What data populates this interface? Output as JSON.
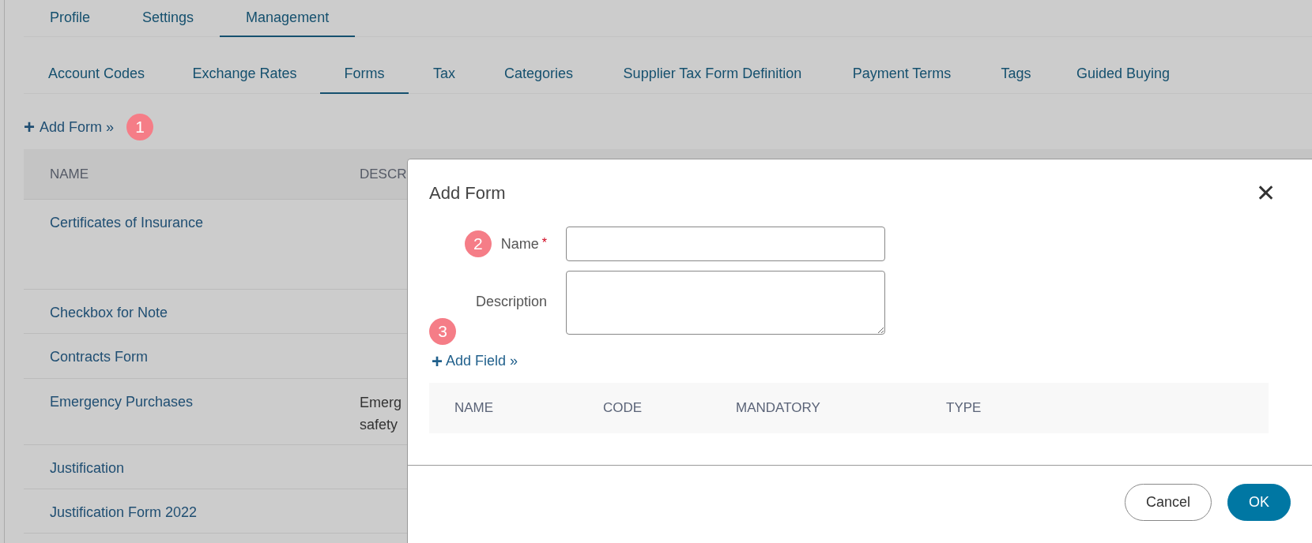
{
  "top_tabs": [
    {
      "label": "Profile",
      "selected": false
    },
    {
      "label": "Settings",
      "selected": false
    },
    {
      "label": "Management",
      "selected": true
    }
  ],
  "sub_tabs": [
    {
      "label": "Account Codes",
      "selected": false
    },
    {
      "label": "Exchange Rates",
      "selected": false
    },
    {
      "label": "Forms",
      "selected": true
    },
    {
      "label": "Tax",
      "selected": false
    },
    {
      "label": "Categories",
      "selected": false
    },
    {
      "label": "Supplier Tax Form Definition",
      "selected": false
    },
    {
      "label": "Payment Terms",
      "selected": false
    },
    {
      "label": "Tags",
      "selected": false
    },
    {
      "label": "Guided Buying",
      "selected": false
    }
  ],
  "add_form_link": {
    "icon": "+",
    "label": "Add Form »",
    "callout": "1"
  },
  "table": {
    "columns": [
      "NAME",
      "DESCR"
    ],
    "rows": [
      {
        "name": "Certificates of Insurance"
      },
      {
        "name": "Checkbox for Note"
      },
      {
        "name": "Contracts Form"
      },
      {
        "name": "Emergency Purchases",
        "description_lines": [
          "Emerg",
          "safety"
        ]
      },
      {
        "name": "Justification"
      },
      {
        "name": "Justification Form 2022"
      }
    ]
  },
  "dialog": {
    "title": "Add Form",
    "close": "✕",
    "required_mark": "*",
    "fields": [
      {
        "kind": "input",
        "label": "Name",
        "required": true,
        "callout": "2"
      },
      {
        "kind": "textarea",
        "label": "Description",
        "required": false
      }
    ],
    "add_field": {
      "icon": "+",
      "label": "Add Field »",
      "callout": "3"
    },
    "columns": [
      "NAME",
      "CODE",
      "MANDATORY",
      "TYPE"
    ],
    "buttons": [
      {
        "kind": "secondary",
        "label": "Cancel"
      },
      {
        "kind": "primary",
        "label": "OK"
      }
    ]
  }
}
